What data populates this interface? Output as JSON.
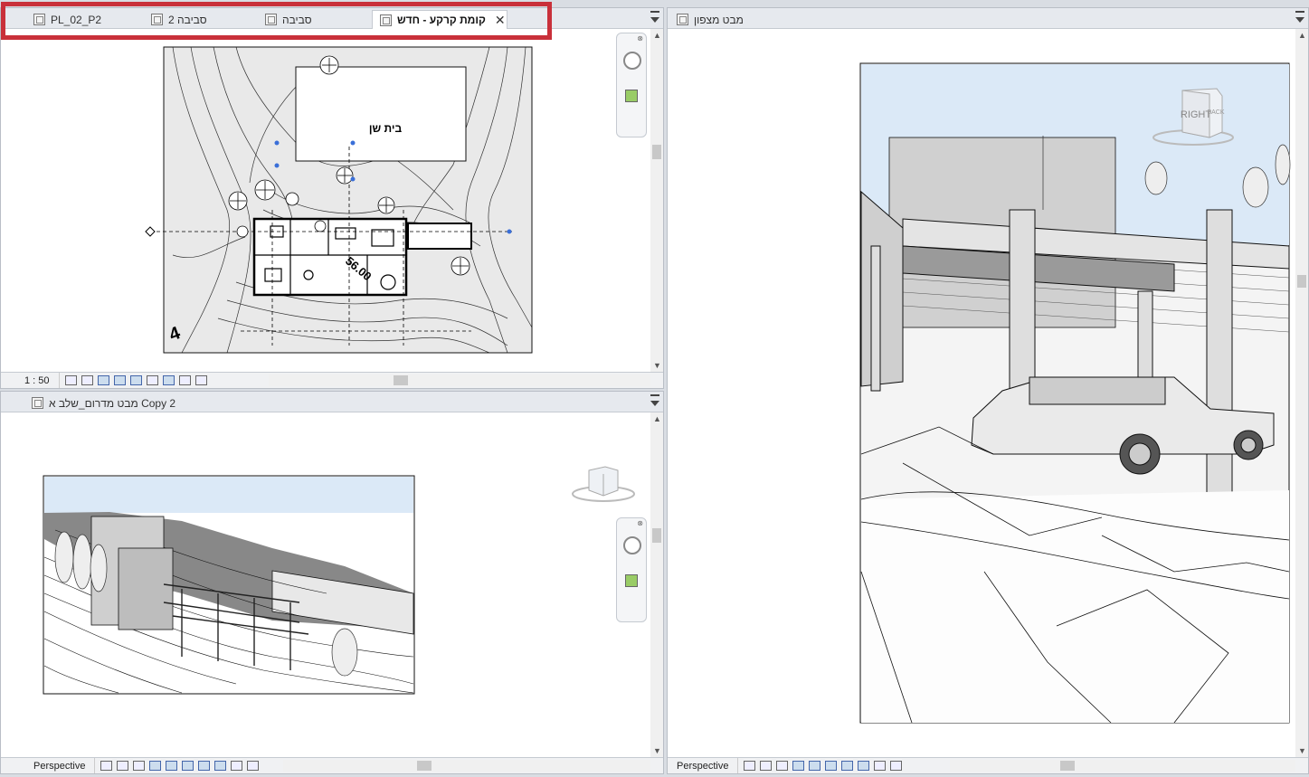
{
  "top_left_pane": {
    "tabs": [
      {
        "label": "PL_02_P2",
        "active": false
      },
      {
        "label": "סביבה 2",
        "active": false
      },
      {
        "label": "סביבה",
        "active": false
      },
      {
        "label": "קומת קרקע - חדש",
        "active": true
      }
    ],
    "close_symbol": "✕",
    "plan_labels": {
      "building": "בית שן",
      "level": "56.00",
      "north_mark": "4"
    },
    "scale": "1 : 50"
  },
  "bottom_left_pane": {
    "tab_label": "מבט מדרום_שלב א Copy 2",
    "status_label": "Perspective"
  },
  "right_pane": {
    "tab_label": "מבט מצפון",
    "status_label": "Perspective",
    "cube_faces": {
      "front": "RIGHT",
      "side": "BACK"
    }
  },
  "colors": {
    "highlight": "#c9303a",
    "sky": "#dbe9f7",
    "ground": "#f2f2f2"
  }
}
